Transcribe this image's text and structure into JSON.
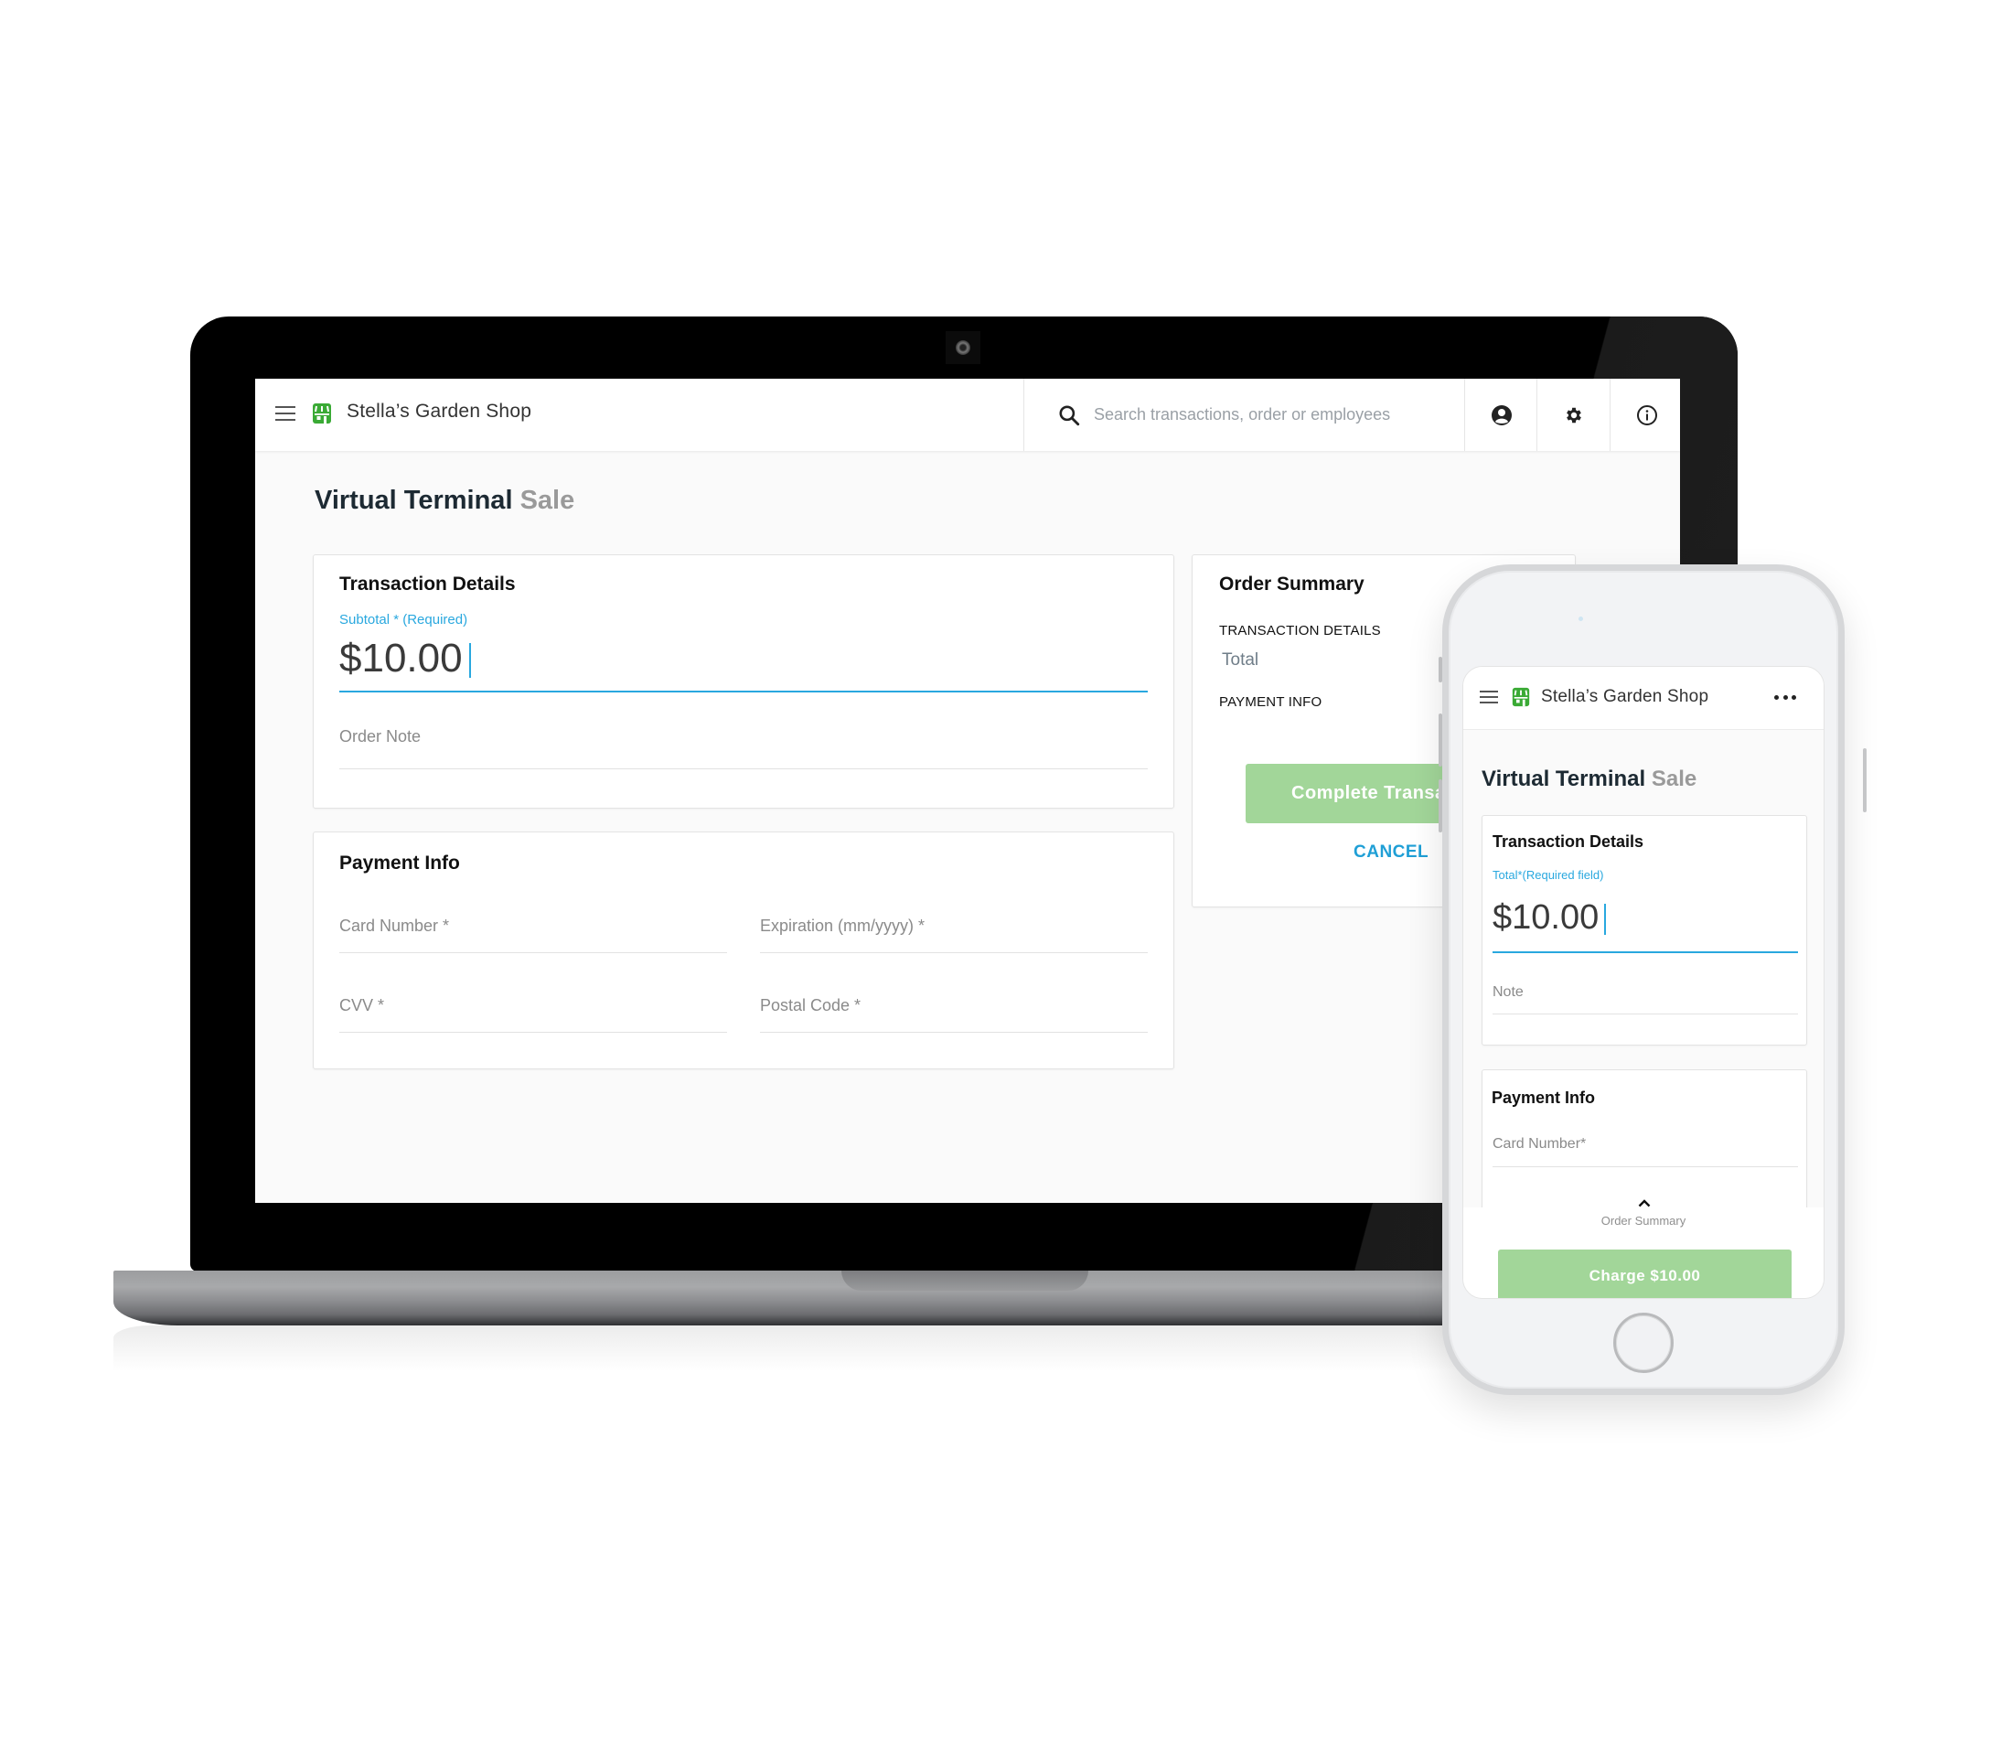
{
  "desktop": {
    "header": {
      "menu_icon": "hamburger-menu-icon",
      "store_icon": "storefront-icon",
      "shop_name": "Stella’s Garden Shop",
      "search_icon": "search-icon",
      "search_placeholder": "Search transactions, order or employees",
      "search_value": "",
      "account_icon": "account-circle-icon",
      "settings_icon": "gear-icon",
      "info_icon": "info-icon"
    },
    "page_title": {
      "main": "Virtual Terminal",
      "sub": "Sale"
    },
    "transaction_details": {
      "title": "Transaction Details",
      "subtotal_label": "Subtotal * (Required)",
      "subtotal_value": "$10.00",
      "order_note_placeholder": "Order Note"
    },
    "payment_info": {
      "title": "Payment Info",
      "card_number_label": "Card Number *",
      "expiration_label": "Expiration (mm/yyyy) *",
      "cvv_label": "CVV *",
      "postal_code_label": "Postal Code *"
    },
    "order_summary": {
      "title": "Order Summary",
      "transaction_details_heading": "TRANSACTION DETAILS",
      "total_label": "Total",
      "payment_info_heading": "PAYMENT INFO",
      "complete_button": "Complete Transaction",
      "cancel_button": "CANCEL"
    }
  },
  "mobile": {
    "header": {
      "menu_icon": "hamburger-menu-icon",
      "store_icon": "storefront-icon",
      "shop_name": "Stella’s Garden Shop",
      "more_icon": "more-horizontal-icon"
    },
    "page_title": {
      "main": "Virtual Terminal",
      "sub": "Sale"
    },
    "transaction_details": {
      "title": "Transaction Details",
      "total_label": "Total*(Required field)",
      "total_value": "$10.00",
      "note_placeholder": "Note"
    },
    "payment_info": {
      "title": "Payment Info",
      "card_number_label": "Card Number*"
    },
    "bottom_sheet": {
      "chevron_icon": "chevron-up-icon",
      "label": "Order Summary",
      "charge_button": "Charge $10.00"
    }
  },
  "colors": {
    "brand_green": "#3aaa35",
    "accent_blue": "#29a8df",
    "button_green_disabled": "#a2d699",
    "title_dark": "#1d2a33",
    "subtitle_gray": "#9a9a9a"
  }
}
